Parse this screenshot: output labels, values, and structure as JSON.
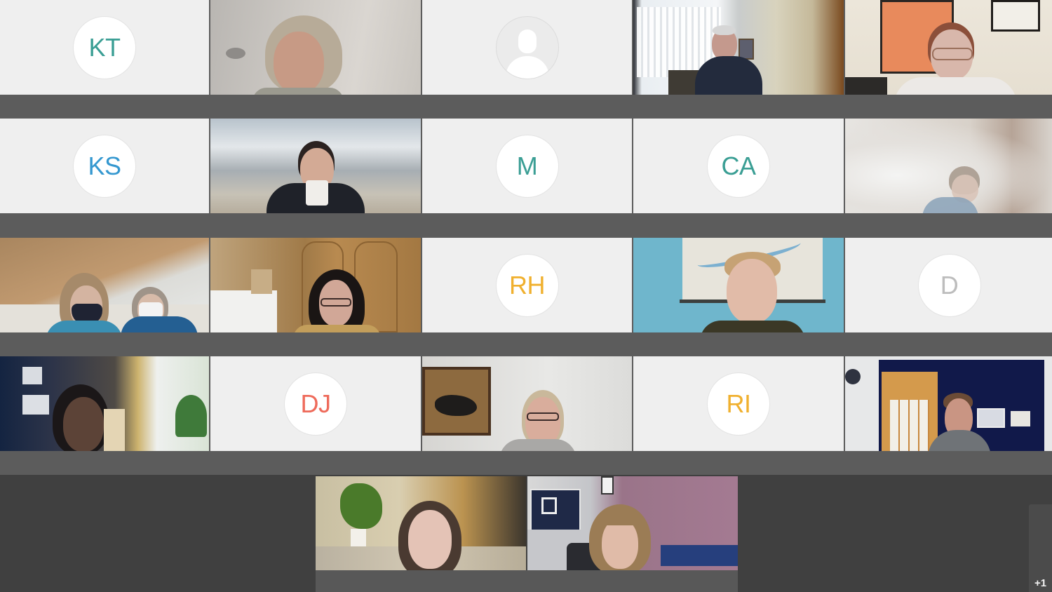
{
  "app": {
    "view": "gallery-view"
  },
  "colors": {
    "teal": "#3a9e94",
    "blue": "#3598d0",
    "amber": "#f0b02e",
    "salmon": "#ee6a5a",
    "grey": "#bdbdbd",
    "tile_bg": "#efefef",
    "divider": "#5c5c5c",
    "bottom_bg": "#404040"
  },
  "participants": [
    {
      "type": "avatar",
      "initials": "KT",
      "color": "teal"
    },
    {
      "type": "video",
      "scene": "older-woman-grey-hair"
    },
    {
      "type": "placeholder",
      "icon": "person-silhouette-icon"
    },
    {
      "type": "video",
      "scene": "man-office-window-blinds"
    },
    {
      "type": "video",
      "scene": "woman-glasses-orange-poster"
    },
    {
      "type": "avatar",
      "initials": "KS",
      "color": "blue"
    },
    {
      "type": "video",
      "scene": "woman-drinking-mug-blurred-bg"
    },
    {
      "type": "avatar",
      "initials": "M",
      "color": "teal"
    },
    {
      "type": "avatar",
      "initials": "CA",
      "color": "teal"
    },
    {
      "type": "video",
      "scene": "woman-blurred-bg"
    },
    {
      "type": "video",
      "scene": "two-women-masks-attic"
    },
    {
      "type": "video",
      "scene": "woman-dark-hair-glasses-wood-cabinets"
    },
    {
      "type": "avatar",
      "initials": "RH",
      "color": "amber"
    },
    {
      "type": "video",
      "scene": "young-man-map-blue-wall"
    },
    {
      "type": "avatar",
      "initials": "D",
      "color": "grey"
    },
    {
      "type": "video",
      "scene": "woman-dark-room-window"
    },
    {
      "type": "avatar",
      "initials": "DJ",
      "color": "salmon"
    },
    {
      "type": "video",
      "scene": "woman-glasses-horse-painting"
    },
    {
      "type": "avatar",
      "initials": "RI",
      "color": "amber"
    },
    {
      "type": "video",
      "scene": "man-beard-navy-wall"
    }
  ],
  "bottom_row": [
    {
      "type": "video",
      "scene": "young-woman-plant-couch"
    },
    {
      "type": "video",
      "scene": "woman-bangs-pink-wall"
    }
  ],
  "overflow": {
    "label": "+1"
  }
}
